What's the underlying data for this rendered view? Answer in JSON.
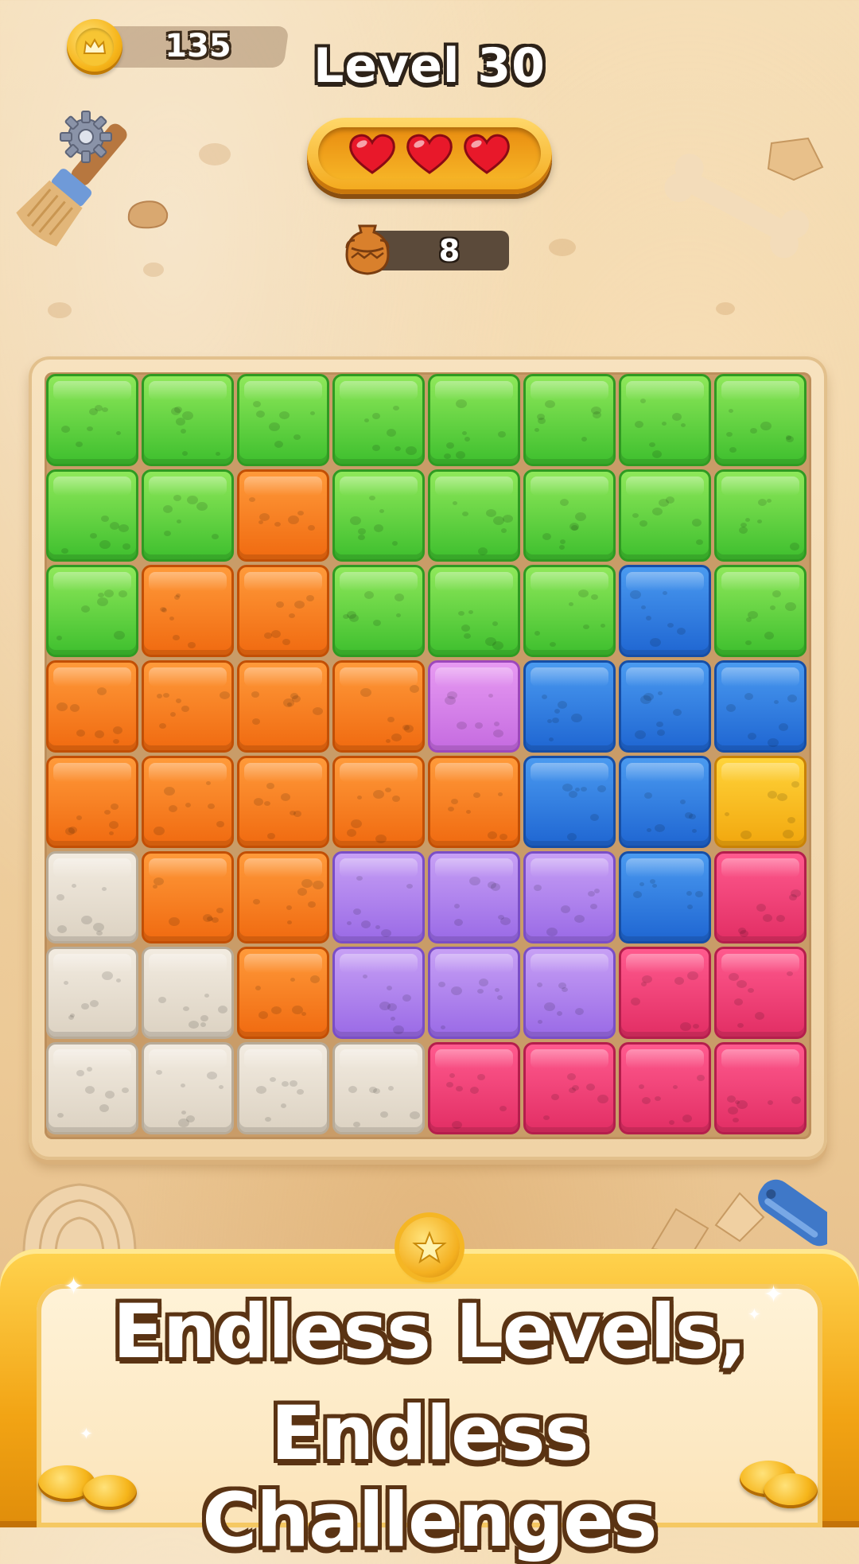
{
  "hud": {
    "coins": "135",
    "level_title": "Level 30",
    "lives": 3,
    "target_jars": "8"
  },
  "icons": {
    "currency": "crown-coin-icon",
    "target": "clay-jar-icon",
    "settings": "gear-icon",
    "life": "heart-icon"
  },
  "board": {
    "rows": 8,
    "cols": 8,
    "grid": [
      [
        "G",
        "G",
        "G",
        "G",
        "G",
        "G",
        "G",
        "G"
      ],
      [
        "G",
        "G",
        "O",
        "G",
        "G",
        "G",
        "G",
        "G"
      ],
      [
        "G",
        "O",
        "O",
        "G",
        "G",
        "G",
        "B",
        "G"
      ],
      [
        "O",
        "O",
        "O",
        "O",
        "P",
        "B",
        "B",
        "B"
      ],
      [
        "O",
        "O",
        "O",
        "O",
        "O",
        "B",
        "B",
        "Y"
      ],
      [
        "S",
        "O",
        "O",
        "V",
        "V",
        "V",
        "B",
        "R"
      ],
      [
        "S",
        "S",
        "O",
        "V",
        "V",
        "V",
        "R",
        "R"
      ],
      [
        "S",
        "S",
        "S",
        "S",
        "R",
        "R",
        "R",
        "R"
      ]
    ],
    "palette": {
      "G": {
        "name": "green",
        "top": "#8fe85a",
        "bottom": "#3ebf2e",
        "border": "#2f9a22"
      },
      "O": {
        "name": "orange",
        "top": "#ff9a3a",
        "bottom": "#f06a10",
        "border": "#c24f05"
      },
      "B": {
        "name": "blue",
        "top": "#4a9af0",
        "bottom": "#1f66d2",
        "border": "#164ea6"
      },
      "P": {
        "name": "pink-purple",
        "top": "#e79af2",
        "bottom": "#c56be0",
        "border": "#9d48bb"
      },
      "Y": {
        "name": "yellow",
        "top": "#ffd43a",
        "bottom": "#f2a70e",
        "border": "#c98206"
      },
      "V": {
        "name": "violet",
        "top": "#c7a0f5",
        "bottom": "#9a6ae6",
        "border": "#7a4ec6"
      },
      "R": {
        "name": "pink",
        "top": "#ff5a8e",
        "bottom": "#e22e64",
        "border": "#b41e4c"
      },
      "S": {
        "name": "sand",
        "top": "#f2ebe0",
        "bottom": "#dcd2c2",
        "border": "#b8ab98"
      }
    }
  },
  "banner": {
    "line1": "Endless Levels,",
    "line2": "Endless Challenges"
  },
  "colors": {
    "gold": "#f6b51a",
    "heart": "#e8182a",
    "outline": "#2d2218"
  }
}
